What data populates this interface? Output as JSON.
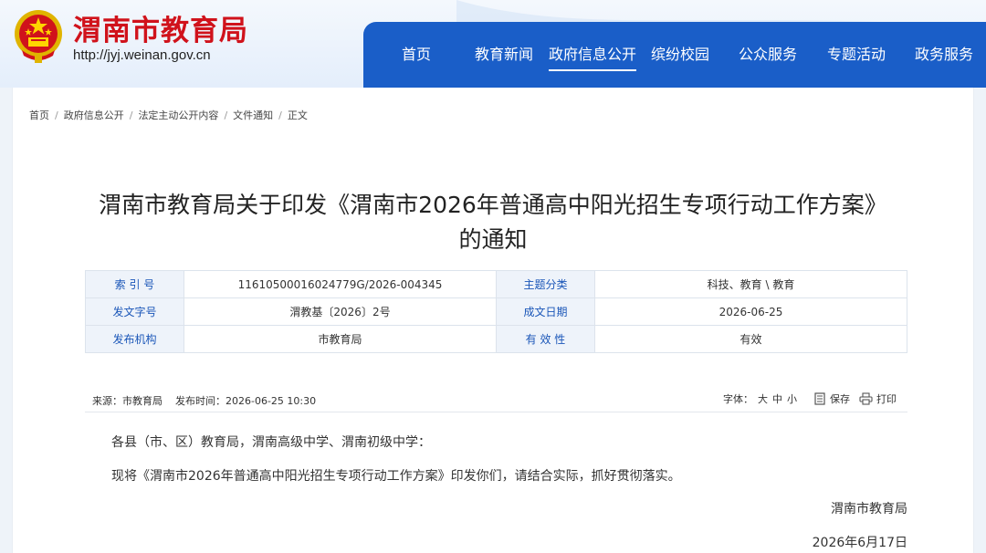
{
  "site": {
    "name": "渭南市教育局",
    "url": "http://jyj.weinan.gov.cn"
  },
  "nav": {
    "items": [
      "首页",
      "教育新闻",
      "政府信息公开",
      "缤纷校园",
      "公众服务",
      "专题活动",
      "政务服务"
    ],
    "active": "政府信息公开"
  },
  "breadcrumb": [
    "首页",
    "政府信息公开",
    "法定主动公开内容",
    "文件通知",
    "正文"
  ],
  "article": {
    "title_line1": "渭南市教育局关于印发《渭南市2026年普通高中阳光招生专项行动工作方案》",
    "title_line2": "的通知"
  },
  "meta": {
    "index_label": "索 引 号",
    "index_value": "11610500016024779G/2026-004345",
    "topic_label": "主题分类",
    "topic_value": "科技、教育 \\ 教育",
    "doc_no_label": "发文字号",
    "doc_no_value": "渭教基〔2026〕2号",
    "date_label": "成文日期",
    "date_value": "2026-06-25",
    "issuer_label": "发布机构",
    "issuer_value": "市教育局",
    "validity_label": "有 效 性",
    "validity_value": "有效"
  },
  "source_bar": {
    "source": "来源：市教育局",
    "publish_time": "发布时间：2026-06-25 10:30",
    "font_label": "字体：",
    "size_large": "大",
    "size_medium": "中",
    "size_small": "小",
    "save_label": "保存",
    "print_label": "打印"
  },
  "content": {
    "salutation": "各县（市、区）教育局，渭南高级中学、渭南初级中学：",
    "paragraph": "现将《渭南市2026年普通高中阳光招生专项行动工作方案》印发你们，请结合实际，抓好贯彻落实。",
    "signer": "渭南市教育局",
    "sign_date": "2026年6月17日"
  },
  "colors": {
    "brand_red": "#d0121b",
    "nav_blue": "#1a5ec8",
    "label_blue": "#1a56b8"
  },
  "icons": {
    "emblem": "national-emblem-icon",
    "save": "save-icon",
    "print": "print-icon"
  }
}
